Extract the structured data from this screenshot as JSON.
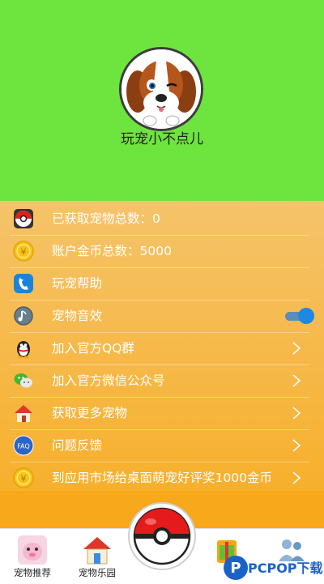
{
  "profile": {
    "username": "玩宠小不点儿"
  },
  "menu": {
    "items": [
      {
        "label": "已获取宠物总数：0",
        "icon": "pokeball-icon",
        "action": "none"
      },
      {
        "label": "账户金币总数：5000",
        "icon": "coin-icon",
        "action": "none"
      },
      {
        "label": "玩宠帮助",
        "icon": "help-phone-icon",
        "action": "none"
      },
      {
        "label": "宠物音效",
        "icon": "sound-icon",
        "action": "toggle",
        "toggle_on": true
      },
      {
        "label": "加入官方QQ群",
        "icon": "qq-penguin-icon",
        "action": "chevron"
      },
      {
        "label": "加入官方微信公众号",
        "icon": "wechat-icon",
        "action": "chevron"
      },
      {
        "label": "获取更多宠物",
        "icon": "house-icon",
        "action": "chevron"
      },
      {
        "label": "问题反馈",
        "icon": "faq-icon",
        "action": "chevron"
      },
      {
        "label": "到应用市场给桌面萌宠好评奖1000金币",
        "icon": "coin-icon",
        "action": "chevron"
      }
    ]
  },
  "tabbar": {
    "tabs": [
      {
        "label": "宠物推荐",
        "icon": "pet-recommend-icon"
      },
      {
        "label": "宠物乐园",
        "icon": "pet-park-house-icon"
      },
      {
        "label": "",
        "icon": "pokeball-center-icon"
      },
      {
        "label": "",
        "icon": "gift-icon"
      },
      {
        "label": "",
        "icon": "users-icon"
      }
    ]
  },
  "watermark": {
    "text": "PCPOP下载"
  },
  "colors": {
    "header_green": "#6ee43f",
    "menu_orange": "#f7b02c",
    "toggle_blue": "#1e88e5"
  }
}
